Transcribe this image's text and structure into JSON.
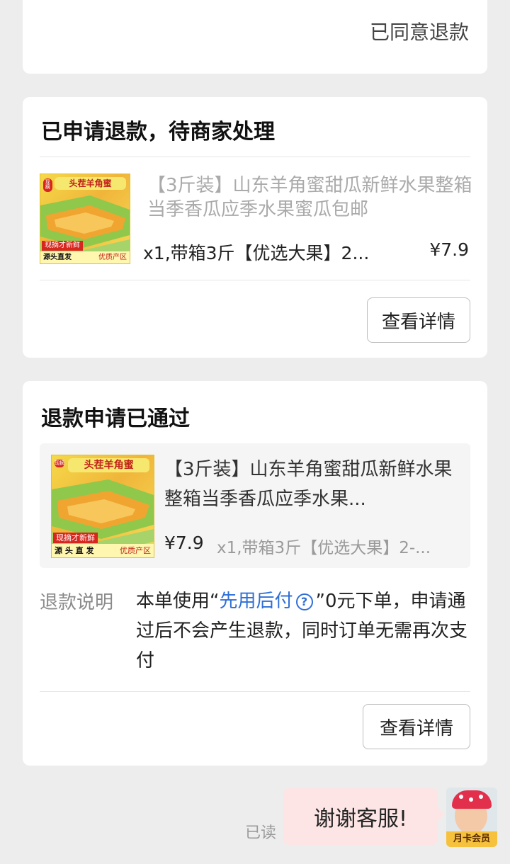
{
  "top_card": {
    "status": "已同意退款"
  },
  "pending_card": {
    "title": "已申请退款，待商家处理",
    "product": {
      "title": "【3斤装】山东羊角蜜甜瓜新鲜水果整箱当季香瓜应季水果蜜瓜包邮",
      "spec": "x1,带箱3斤【优选大果】2...",
      "price": "¥7.9",
      "thumb": {
        "top_text": "头茬羊角蜜",
        "side_text": "现摘",
        "red_text": "现摘才新鲜",
        "bottom_left": "源头直发",
        "bottom_right": "优质产区"
      }
    },
    "detail_button": "查看详情"
  },
  "approved_card": {
    "title": "退款申请已通过",
    "product": {
      "title": "【3斤装】山东羊角蜜甜瓜新鲜水果整箱当季香瓜应季水果...",
      "price": "¥7.9",
      "spec": "x1,带箱3斤【优选大果】2-...",
      "thumb": {
        "top_text": "头茬羊角蜜",
        "side_text": "现摘",
        "red_text": "现摘才新鲜",
        "bottom_left": "源 头 直 发",
        "bottom_right": "优质产区"
      }
    },
    "refund": {
      "label": "退款说明",
      "text_prefix": "本单使用“",
      "link_text": "先用后付",
      "help_icon": "?",
      "text_suffix": "”0元下单，申请通过后不会产生退款，同时订单无需再次支付"
    },
    "detail_button": "查看详情"
  },
  "chat": {
    "read_status": "已读",
    "message": "谢谢客服!",
    "avatar_badge": "月卡会员"
  },
  "colors": {
    "background": "#ededed",
    "card": "#ffffff",
    "link": "#2f6fd6",
    "bubble": "#fde5e5"
  }
}
